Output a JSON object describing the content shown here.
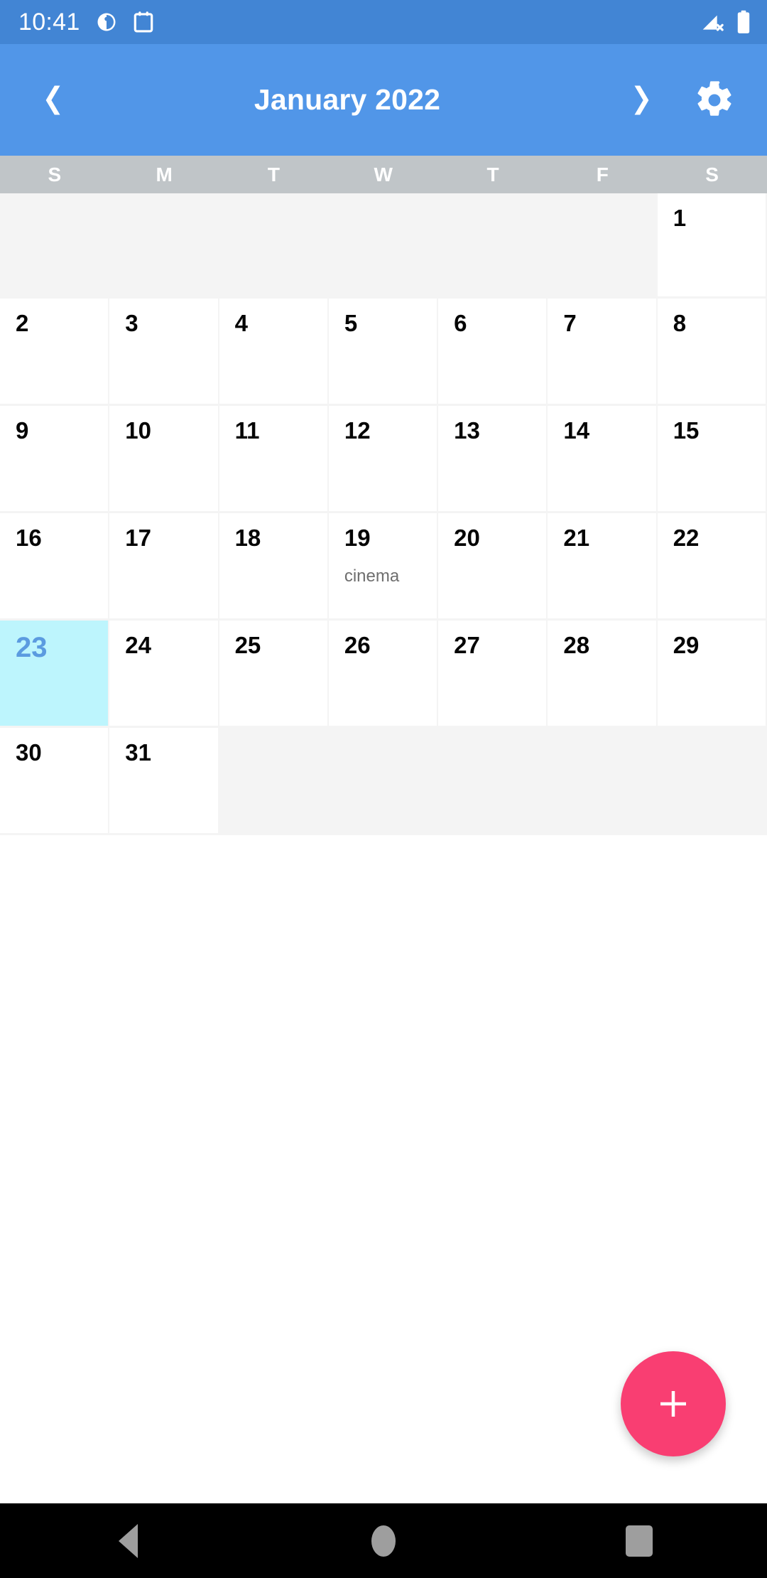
{
  "status_bar": {
    "time": "10:41",
    "icons_left": [
      "notification-circle-icon",
      "calendar-notification-icon"
    ],
    "icons_right": [
      "signal-no-service-icon",
      "battery-full-icon"
    ],
    "background_color": "#4285D4"
  },
  "app_bar": {
    "title": "January 2022",
    "prev_label": "prev-month-button",
    "next_label": "next-month-button",
    "settings_label": "settings-button",
    "background_color": "#5196E8"
  },
  "weekdays": [
    "S",
    "M",
    "T",
    "W",
    "T",
    "F",
    "S"
  ],
  "calendar": {
    "month": "January",
    "year": "2022",
    "today": "23",
    "today_bg_color": "#BDF5FD",
    "today_text_color": "#5B9BE0",
    "weeks": [
      [
        {
          "day": "",
          "events": []
        },
        {
          "day": "",
          "events": []
        },
        {
          "day": "",
          "events": []
        },
        {
          "day": "",
          "events": []
        },
        {
          "day": "",
          "events": []
        },
        {
          "day": "",
          "events": []
        },
        {
          "day": "1",
          "events": []
        }
      ],
      [
        {
          "day": "2",
          "events": []
        },
        {
          "day": "3",
          "events": []
        },
        {
          "day": "4",
          "events": []
        },
        {
          "day": "5",
          "events": []
        },
        {
          "day": "6",
          "events": []
        },
        {
          "day": "7",
          "events": []
        },
        {
          "day": "8",
          "events": []
        }
      ],
      [
        {
          "day": "9",
          "events": []
        },
        {
          "day": "10",
          "events": []
        },
        {
          "day": "11",
          "events": []
        },
        {
          "day": "12",
          "events": []
        },
        {
          "day": "13",
          "events": []
        },
        {
          "day": "14",
          "events": []
        },
        {
          "day": "15",
          "events": []
        }
      ],
      [
        {
          "day": "16",
          "events": []
        },
        {
          "day": "17",
          "events": []
        },
        {
          "day": "18",
          "events": []
        },
        {
          "day": "19",
          "events": [
            "cinema"
          ]
        },
        {
          "day": "20",
          "events": []
        },
        {
          "day": "21",
          "events": []
        },
        {
          "day": "22",
          "events": []
        }
      ],
      [
        {
          "day": "23",
          "events": [],
          "today": true
        },
        {
          "day": "24",
          "events": []
        },
        {
          "day": "25",
          "events": []
        },
        {
          "day": "26",
          "events": []
        },
        {
          "day": "27",
          "events": []
        },
        {
          "day": "28",
          "events": []
        },
        {
          "day": "29",
          "events": []
        }
      ],
      [
        {
          "day": "30",
          "events": []
        },
        {
          "day": "31",
          "events": []
        },
        {
          "day": "",
          "events": []
        },
        {
          "day": "",
          "events": []
        },
        {
          "day": "",
          "events": []
        },
        {
          "day": "",
          "events": []
        },
        {
          "day": "",
          "events": []
        }
      ]
    ]
  },
  "fab": {
    "label": "+",
    "name": "add-event-button",
    "color": "#F93E72"
  },
  "nav_bar": {
    "back": "back-button",
    "home": "home-button",
    "recents": "recents-button"
  }
}
